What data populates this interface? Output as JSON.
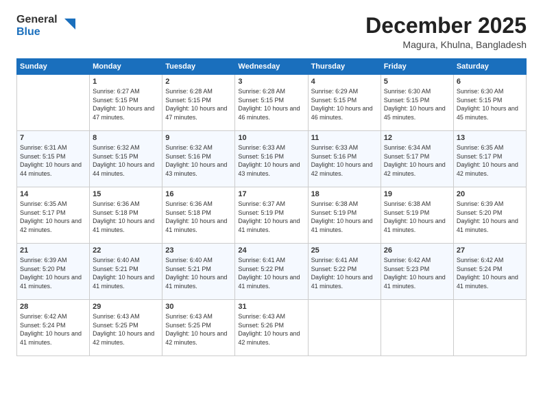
{
  "logo": {
    "general": "General",
    "blue": "Blue"
  },
  "header": {
    "month": "December 2025",
    "location": "Magura, Khulna, Bangladesh"
  },
  "weekdays": [
    "Sunday",
    "Monday",
    "Tuesday",
    "Wednesday",
    "Thursday",
    "Friday",
    "Saturday"
  ],
  "weeks": [
    [
      {
        "day": "",
        "sunrise": "",
        "sunset": "",
        "daylight": ""
      },
      {
        "day": "1",
        "sunrise": "Sunrise: 6:27 AM",
        "sunset": "Sunset: 5:15 PM",
        "daylight": "Daylight: 10 hours and 47 minutes."
      },
      {
        "day": "2",
        "sunrise": "Sunrise: 6:28 AM",
        "sunset": "Sunset: 5:15 PM",
        "daylight": "Daylight: 10 hours and 47 minutes."
      },
      {
        "day": "3",
        "sunrise": "Sunrise: 6:28 AM",
        "sunset": "Sunset: 5:15 PM",
        "daylight": "Daylight: 10 hours and 46 minutes."
      },
      {
        "day": "4",
        "sunrise": "Sunrise: 6:29 AM",
        "sunset": "Sunset: 5:15 PM",
        "daylight": "Daylight: 10 hours and 46 minutes."
      },
      {
        "day": "5",
        "sunrise": "Sunrise: 6:30 AM",
        "sunset": "Sunset: 5:15 PM",
        "daylight": "Daylight: 10 hours and 45 minutes."
      },
      {
        "day": "6",
        "sunrise": "Sunrise: 6:30 AM",
        "sunset": "Sunset: 5:15 PM",
        "daylight": "Daylight: 10 hours and 45 minutes."
      }
    ],
    [
      {
        "day": "7",
        "sunrise": "Sunrise: 6:31 AM",
        "sunset": "Sunset: 5:15 PM",
        "daylight": "Daylight: 10 hours and 44 minutes."
      },
      {
        "day": "8",
        "sunrise": "Sunrise: 6:32 AM",
        "sunset": "Sunset: 5:15 PM",
        "daylight": "Daylight: 10 hours and 44 minutes."
      },
      {
        "day": "9",
        "sunrise": "Sunrise: 6:32 AM",
        "sunset": "Sunset: 5:16 PM",
        "daylight": "Daylight: 10 hours and 43 minutes."
      },
      {
        "day": "10",
        "sunrise": "Sunrise: 6:33 AM",
        "sunset": "Sunset: 5:16 PM",
        "daylight": "Daylight: 10 hours and 43 minutes."
      },
      {
        "day": "11",
        "sunrise": "Sunrise: 6:33 AM",
        "sunset": "Sunset: 5:16 PM",
        "daylight": "Daylight: 10 hours and 42 minutes."
      },
      {
        "day": "12",
        "sunrise": "Sunrise: 6:34 AM",
        "sunset": "Sunset: 5:17 PM",
        "daylight": "Daylight: 10 hours and 42 minutes."
      },
      {
        "day": "13",
        "sunrise": "Sunrise: 6:35 AM",
        "sunset": "Sunset: 5:17 PM",
        "daylight": "Daylight: 10 hours and 42 minutes."
      }
    ],
    [
      {
        "day": "14",
        "sunrise": "Sunrise: 6:35 AM",
        "sunset": "Sunset: 5:17 PM",
        "daylight": "Daylight: 10 hours and 42 minutes."
      },
      {
        "day": "15",
        "sunrise": "Sunrise: 6:36 AM",
        "sunset": "Sunset: 5:18 PM",
        "daylight": "Daylight: 10 hours and 41 minutes."
      },
      {
        "day": "16",
        "sunrise": "Sunrise: 6:36 AM",
        "sunset": "Sunset: 5:18 PM",
        "daylight": "Daylight: 10 hours and 41 minutes."
      },
      {
        "day": "17",
        "sunrise": "Sunrise: 6:37 AM",
        "sunset": "Sunset: 5:19 PM",
        "daylight": "Daylight: 10 hours and 41 minutes."
      },
      {
        "day": "18",
        "sunrise": "Sunrise: 6:38 AM",
        "sunset": "Sunset: 5:19 PM",
        "daylight": "Daylight: 10 hours and 41 minutes."
      },
      {
        "day": "19",
        "sunrise": "Sunrise: 6:38 AM",
        "sunset": "Sunset: 5:19 PM",
        "daylight": "Daylight: 10 hours and 41 minutes."
      },
      {
        "day": "20",
        "sunrise": "Sunrise: 6:39 AM",
        "sunset": "Sunset: 5:20 PM",
        "daylight": "Daylight: 10 hours and 41 minutes."
      }
    ],
    [
      {
        "day": "21",
        "sunrise": "Sunrise: 6:39 AM",
        "sunset": "Sunset: 5:20 PM",
        "daylight": "Daylight: 10 hours and 41 minutes."
      },
      {
        "day": "22",
        "sunrise": "Sunrise: 6:40 AM",
        "sunset": "Sunset: 5:21 PM",
        "daylight": "Daylight: 10 hours and 41 minutes."
      },
      {
        "day": "23",
        "sunrise": "Sunrise: 6:40 AM",
        "sunset": "Sunset: 5:21 PM",
        "daylight": "Daylight: 10 hours and 41 minutes."
      },
      {
        "day": "24",
        "sunrise": "Sunrise: 6:41 AM",
        "sunset": "Sunset: 5:22 PM",
        "daylight": "Daylight: 10 hours and 41 minutes."
      },
      {
        "day": "25",
        "sunrise": "Sunrise: 6:41 AM",
        "sunset": "Sunset: 5:22 PM",
        "daylight": "Daylight: 10 hours and 41 minutes."
      },
      {
        "day": "26",
        "sunrise": "Sunrise: 6:42 AM",
        "sunset": "Sunset: 5:23 PM",
        "daylight": "Daylight: 10 hours and 41 minutes."
      },
      {
        "day": "27",
        "sunrise": "Sunrise: 6:42 AM",
        "sunset": "Sunset: 5:24 PM",
        "daylight": "Daylight: 10 hours and 41 minutes."
      }
    ],
    [
      {
        "day": "28",
        "sunrise": "Sunrise: 6:42 AM",
        "sunset": "Sunset: 5:24 PM",
        "daylight": "Daylight: 10 hours and 41 minutes."
      },
      {
        "day": "29",
        "sunrise": "Sunrise: 6:43 AM",
        "sunset": "Sunset: 5:25 PM",
        "daylight": "Daylight: 10 hours and 42 minutes."
      },
      {
        "day": "30",
        "sunrise": "Sunrise: 6:43 AM",
        "sunset": "Sunset: 5:25 PM",
        "daylight": "Daylight: 10 hours and 42 minutes."
      },
      {
        "day": "31",
        "sunrise": "Sunrise: 6:43 AM",
        "sunset": "Sunset: 5:26 PM",
        "daylight": "Daylight: 10 hours and 42 minutes."
      },
      {
        "day": "",
        "sunrise": "",
        "sunset": "",
        "daylight": ""
      },
      {
        "day": "",
        "sunrise": "",
        "sunset": "",
        "daylight": ""
      },
      {
        "day": "",
        "sunrise": "",
        "sunset": "",
        "daylight": ""
      }
    ]
  ]
}
